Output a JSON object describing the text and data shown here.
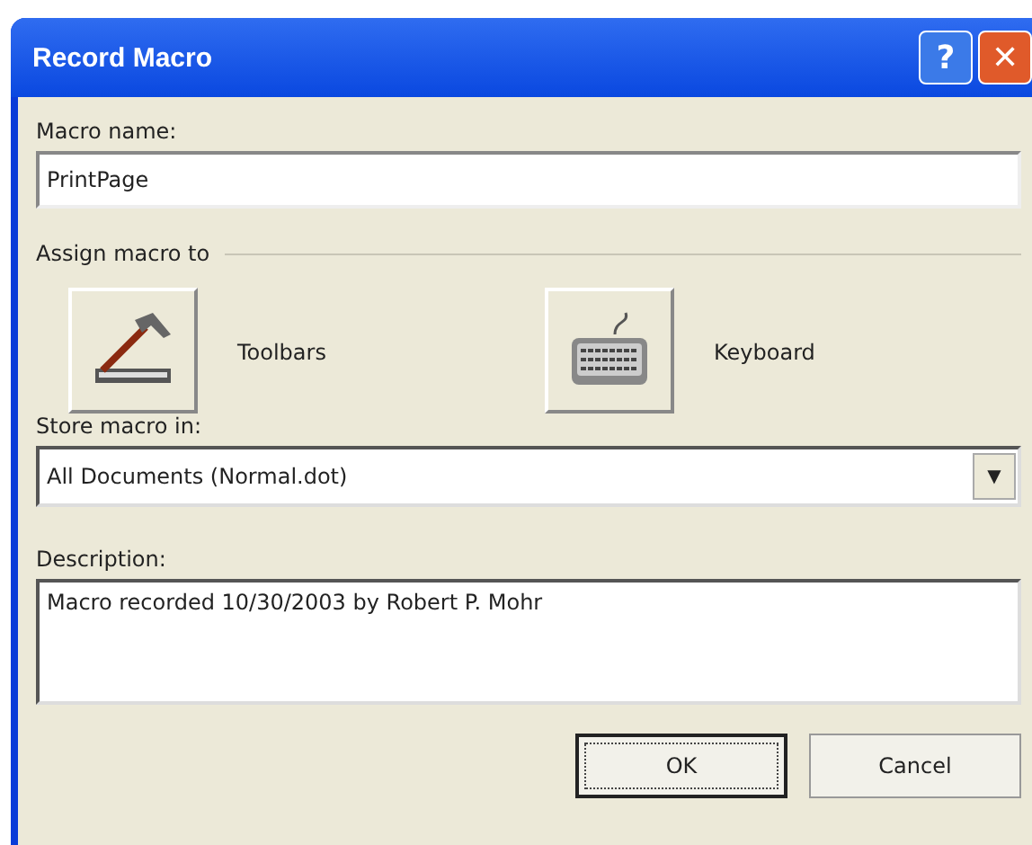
{
  "window": {
    "title": "Record Macro",
    "controls": [
      "?",
      "✕"
    ]
  },
  "macro_name": {
    "label": "Macro name:",
    "value": "PrintPage"
  },
  "assign": {
    "label": "Assign macro to",
    "buttons": [
      {
        "kind": "toolbars",
        "label": "Toolbars"
      },
      {
        "kind": "keyboard",
        "label": "Keyboard"
      }
    ]
  },
  "store": {
    "label": "Store macro in:",
    "value": "All Documents (Normal.dot)",
    "arrow": "▼"
  },
  "description": {
    "label": "Description:",
    "value": "Macro recorded 10/30/2003 by Robert P. Mohr"
  },
  "buttons": [
    {
      "label": "OK",
      "default": true
    },
    {
      "label": "Cancel",
      "default": false
    }
  ]
}
